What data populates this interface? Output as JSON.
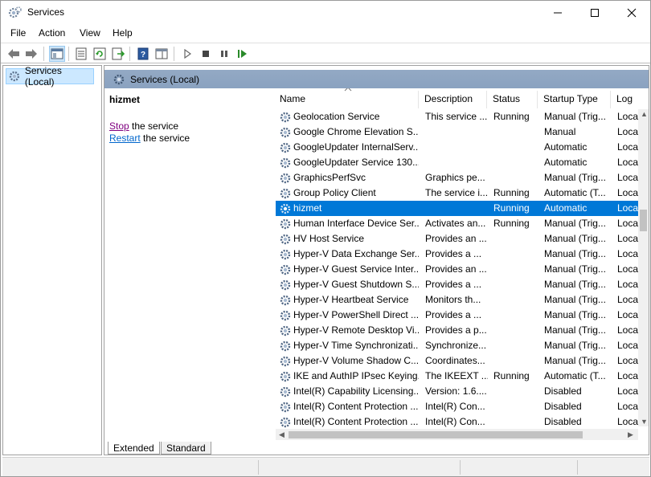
{
  "window": {
    "title": "Services"
  },
  "menu": [
    "File",
    "Action",
    "View",
    "Help"
  ],
  "tree": {
    "root_label": "Services (Local)"
  },
  "pane": {
    "header": "Services (Local)",
    "selected_service": "hizmet",
    "stop_link": "Stop",
    "stop_suffix": " the service",
    "restart_link": "Restart",
    "restart_suffix": " the service"
  },
  "columns": [
    "Name",
    "Description",
    "Status",
    "Startup Type",
    "Log"
  ],
  "rows": [
    {
      "name": "Geolocation Service",
      "description": "This service ...",
      "status": "Running",
      "startup": "Manual (Trig...",
      "log": "Loca"
    },
    {
      "name": "Google Chrome Elevation S...",
      "description": "",
      "status": "",
      "startup": "Manual",
      "log": "Loca"
    },
    {
      "name": "GoogleUpdater InternalServ...",
      "description": "",
      "status": "",
      "startup": "Automatic",
      "log": "Loca"
    },
    {
      "name": "GoogleUpdater Service 130....",
      "description": "",
      "status": "",
      "startup": "Automatic",
      "log": "Loca"
    },
    {
      "name": "GraphicsPerfSvc",
      "description": "Graphics pe...",
      "status": "",
      "startup": "Manual (Trig...",
      "log": "Loca"
    },
    {
      "name": "Group Policy Client",
      "description": "The service i...",
      "status": "Running",
      "startup": "Automatic (T...",
      "log": "Loca"
    },
    {
      "name": "hizmet",
      "description": "",
      "status": "Running",
      "startup": "Automatic",
      "log": "Loca",
      "selected": true
    },
    {
      "name": "Human Interface Device Ser...",
      "description": "Activates an...",
      "status": "Running",
      "startup": "Manual (Trig...",
      "log": "Loca"
    },
    {
      "name": "HV Host Service",
      "description": "Provides an ...",
      "status": "",
      "startup": "Manual (Trig...",
      "log": "Loca"
    },
    {
      "name": "Hyper-V Data Exchange Ser...",
      "description": "Provides a ...",
      "status": "",
      "startup": "Manual (Trig...",
      "log": "Loca"
    },
    {
      "name": "Hyper-V Guest Service Inter...",
      "description": "Provides an ...",
      "status": "",
      "startup": "Manual (Trig...",
      "log": "Loca"
    },
    {
      "name": "Hyper-V Guest Shutdown S...",
      "description": "Provides a ...",
      "status": "",
      "startup": "Manual (Trig...",
      "log": "Loca"
    },
    {
      "name": "Hyper-V Heartbeat Service",
      "description": "Monitors th...",
      "status": "",
      "startup": "Manual (Trig...",
      "log": "Loca"
    },
    {
      "name": "Hyper-V PowerShell Direct ...",
      "description": "Provides a ...",
      "status": "",
      "startup": "Manual (Trig...",
      "log": "Loca"
    },
    {
      "name": "Hyper-V Remote Desktop Vi...",
      "description": "Provides a p...",
      "status": "",
      "startup": "Manual (Trig...",
      "log": "Loca"
    },
    {
      "name": "Hyper-V Time Synchronizati...",
      "description": "Synchronize...",
      "status": "",
      "startup": "Manual (Trig...",
      "log": "Loca"
    },
    {
      "name": "Hyper-V Volume Shadow C...",
      "description": "Coordinates...",
      "status": "",
      "startup": "Manual (Trig...",
      "log": "Loca"
    },
    {
      "name": "IKE and AuthIP IPsec Keying...",
      "description": "The IKEEXT ...",
      "status": "Running",
      "startup": "Automatic (T...",
      "log": "Loca"
    },
    {
      "name": "Intel(R) Capability Licensing...",
      "description": "Version: 1.6....",
      "status": "",
      "startup": "Disabled",
      "log": "Loca"
    },
    {
      "name": "Intel(R) Content Protection ...",
      "description": "Intel(R) Con...",
      "status": "",
      "startup": "Disabled",
      "log": "Loca"
    },
    {
      "name": "Intel(R) Content Protection ...",
      "description": "Intel(R) Con...",
      "status": "",
      "startup": "Disabled",
      "log": "Loca"
    }
  ],
  "tabs": [
    "Extended",
    "Standard"
  ],
  "colors": {
    "selection": "#0078d7",
    "header_bar": "#8fa6c2",
    "tree_selection": "#cce8ff"
  }
}
